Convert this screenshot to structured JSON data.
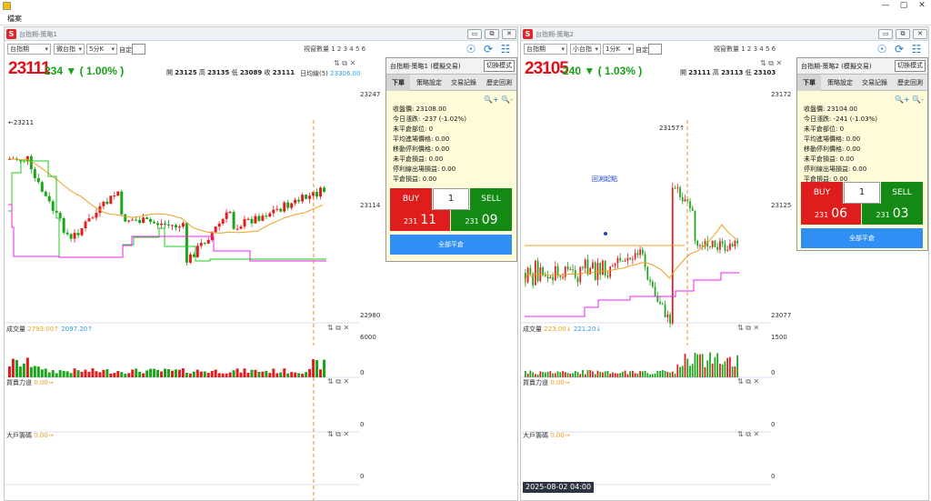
{
  "window": {
    "menu_file": "檔案",
    "minimize": "—",
    "maximize": "▢",
    "close": "✕"
  },
  "panes": [
    {
      "title": "台指期-策略1",
      "selects": [
        "台指期",
        "微台指",
        "5分K"
      ],
      "custom_label": "自定:",
      "window_count": "視窗數量 1 2 3 4 5 6",
      "price": "23111",
      "change": "234 ▼ ( 1.00% )",
      "ohlc": {
        "o_label": "開",
        "o": "23125",
        "h_label": "高",
        "h": "23135",
        "l_label": "低",
        "l": "23089",
        "c_label": "收",
        "c": "23111"
      },
      "ma_label": "日均線(5)",
      "ma_value": "23306.00",
      "axis": {
        "top": "23247",
        "mid": "23114",
        "bottom": "22980"
      },
      "prev_marker": "←23211",
      "volume": {
        "label": "成交量",
        "v1": "2793.00↑",
        "v2": "2097.20↑",
        "top": "6000",
        "zero": "0"
      },
      "buysell": {
        "label": "買賣力道",
        "value": "0.00→",
        "zero": "0"
      },
      "bigplayer": {
        "label": "大戶籌碼",
        "value": "0.00→",
        "zero": "0"
      }
    },
    {
      "title": "台指期-策略2",
      "selects": [
        "台指期",
        "小台指",
        "1分K"
      ],
      "custom_label": "自定:",
      "window_count": "視窗數量 1 2 3 4 5 6",
      "price": "23105",
      "change": "240 ▼ ( 1.03% )",
      "ohlc": {
        "o_label": "開",
        "o": "23111",
        "h_label": "高",
        "h": "23113",
        "l_label": "低",
        "l": "23103",
        "c_label": "收",
        "c": "23105"
      },
      "axis": {
        "top": "23172",
        "mid": "23125",
        "bottom": "23077"
      },
      "prev_marker": "23157↑",
      "backtest_label": "回測起點",
      "volume": {
        "label": "成交量",
        "v1": "223.00↓",
        "v2": "221.20↓",
        "top": "1500",
        "zero": "0"
      },
      "buysell": {
        "label": "買賣力道",
        "value": "0.00→",
        "zero": "0"
      },
      "bigplayer": {
        "label": "大戶籌碼",
        "value": "0.00→",
        "zero": "0"
      },
      "timestamp": "2025-08-02  04:00"
    }
  ],
  "panels": [
    {
      "title": "台指期-策略1 (模擬交易)",
      "switch": "切換模式",
      "tabs": [
        "下單",
        "策略設定",
        "交易記錄",
        "歷史回測"
      ],
      "info": [
        "收盤價: 23108.00",
        "今日漲跌: -237 (-1.02%)",
        "未平倉部位: 0",
        "平均進場價格: 0.00",
        "移動停利價格: 0.00",
        "未平倉損益: 0.00",
        "停利線出場損益: 0.00",
        "平倉損益: 0.00"
      ],
      "buy": "BUY",
      "qty": "1",
      "sell": "SELL",
      "bid_small": "231",
      "bid_large": "11",
      "ask_small": "231",
      "ask_large": "09",
      "close_all": "全部平倉"
    },
    {
      "title": "台指期-策略2 (模擬交易)",
      "switch": "切換模式",
      "tabs": [
        "下單",
        "策略設定",
        "交易記錄",
        "歷史回測"
      ],
      "info": [
        "收盤價: 23104.00",
        "今日漲跌: -241 (-1.03%)",
        "未平倉部位: 0",
        "平均進場價格: 0.00",
        "移動停利價格: 0.00",
        "未平倉損益: 0.00",
        "停利線出場損益: 0.00",
        "平倉損益: 0.00"
      ],
      "buy": "BUY",
      "qty": "1",
      "sell": "SELL",
      "bid_small": "231",
      "bid_large": "06",
      "ask_small": "231",
      "ask_large": "03",
      "close_all": "全部平倉"
    }
  ],
  "colors": {
    "up": "#e01d1d",
    "down": "#1aa51a",
    "ma_orange": "#f0a020",
    "green_line": "#22cc22",
    "magenta": "#ee22ee",
    "dash": "#f08a20"
  }
}
